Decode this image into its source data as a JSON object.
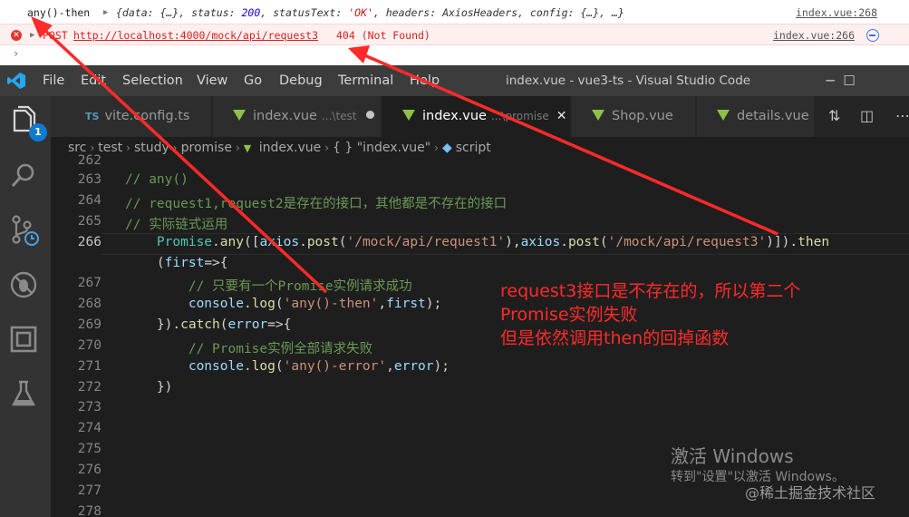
{
  "console": {
    "row1": {
      "text": "any()-then",
      "obj_a": "{data: {…}, status: ",
      "status": "200",
      "obj_b": ", statusText: ",
      "status_text": "'OK'",
      "obj_c": ", headers: AxiosHeaders, config: {…}, …}",
      "source": "index.vue:268"
    },
    "row2": {
      "method": "POST",
      "url": "http://localhost:4000/mock/api/request3",
      "status": "404 (Not Found)",
      "source": "index.vue:266"
    },
    "prompt": "›"
  },
  "titlebar": {
    "menus": [
      "File",
      "Edit",
      "Selection",
      "View",
      "Go",
      "Debug",
      "Terminal",
      "Help"
    ],
    "title": "index.vue - vue3-ts - Visual Studio Code",
    "minimize": "─",
    "maximize": "☐"
  },
  "activity_bar": {
    "badge": "1"
  },
  "tabs": [
    {
      "prefix": "TS",
      "label": "vite.config.ts",
      "desc": ""
    },
    {
      "label": "index.vue",
      "desc": "...\\test"
    },
    {
      "label": "index.vue",
      "desc": "...\\promise"
    },
    {
      "label": "Shop.vue",
      "desc": ""
    },
    {
      "label": "details.vue",
      "desc": ""
    }
  ],
  "tab_actions": {
    "compare": "⇅",
    "split": "◫",
    "more": "⋯"
  },
  "breadcrumb": {
    "items": [
      "src",
      "test",
      "study",
      "promise",
      "index.vue",
      "{ } \"index.vue\"",
      "script"
    ],
    "sep": "›"
  },
  "editor": {
    "line_numbers": [
      "262",
      "263",
      "264",
      "265",
      "266",
      "",
      "267",
      "268",
      "269",
      "270",
      "271",
      "272",
      "273",
      "274",
      "275",
      "276",
      "277",
      "278"
    ],
    "current_line": "266"
  },
  "annotation": {
    "line1": "request3接口是不存在的，所以第二个",
    "line2": "Promise实例失败",
    "line3": "但是依然调用then的回掉函数"
  },
  "watermark": {
    "title": "激活 Windows",
    "subtitle": "转到\"设置\"以激活 Windows。",
    "brand": "@稀土掘金技术社区"
  },
  "colors": {
    "annotation": "#ff2a2a",
    "accent": "#0e7ad1",
    "vue_icon": "#8dc149"
  }
}
